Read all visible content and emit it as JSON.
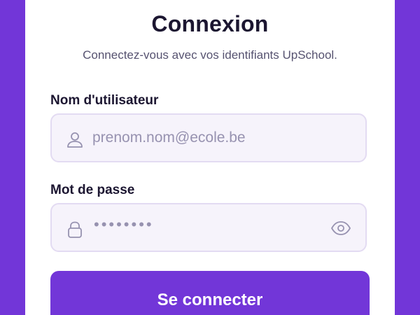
{
  "login": {
    "title": "Connexion",
    "subtitle": "Connectez-vous avec vos identifiants UpSchool.",
    "username": {
      "label": "Nom d'utilisateur",
      "placeholder": "prenom.nom@ecole.be",
      "icon": "user-icon"
    },
    "password": {
      "label": "Mot de passe",
      "masked_value": "••••••••",
      "icon": "lock-icon",
      "toggle_icon": "eye-icon"
    },
    "submit_label": "Se connecter"
  },
  "colors": {
    "brand": "#7236d8",
    "text": "#1c1631",
    "muted": "#565270",
    "placeholder": "#9792b0",
    "input_bg": "#f6f3fb",
    "input_border": "#e3dbf2"
  }
}
